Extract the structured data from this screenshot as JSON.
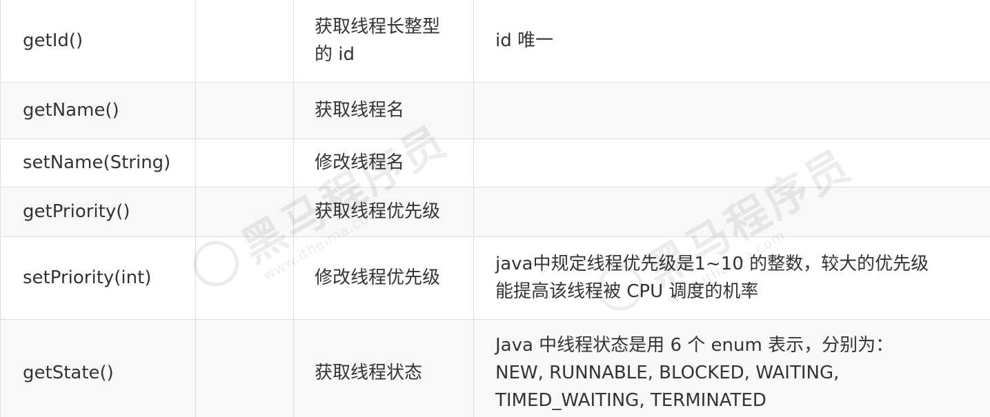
{
  "table": {
    "rows": [
      {
        "method": "getId()",
        "extra": "",
        "description": [
          "获取线程长整型",
          "的 id"
        ],
        "note": [
          "id 唯一"
        ]
      },
      {
        "method": "getName()",
        "extra": "",
        "description": [
          "获取线程名"
        ],
        "note": []
      },
      {
        "method": "setName(String)",
        "extra": "",
        "description": [
          "修改线程名"
        ],
        "note": []
      },
      {
        "method": "getPriority()",
        "extra": "",
        "description": [
          "获取线程优先级"
        ],
        "note": []
      },
      {
        "method": "setPriority(int)",
        "extra": "",
        "description": [
          "修改线程优先级"
        ],
        "note": [
          "java中规定线程优先级是1~10 的整数，较大的优先级",
          "能提高该线程被 CPU 调度的机率"
        ]
      },
      {
        "method": "getState()",
        "extra": "",
        "description": [
          "获取线程状态"
        ],
        "note": [
          "Java 中线程状态是用 6 个 enum 表示，分别为：",
          "NEW, RUNNABLE, BLOCKED, WAITING,",
          "TIMED_WAITING, TERMINATED"
        ]
      }
    ]
  },
  "watermark": {
    "brand": "黑马程序员",
    "url": "www.itheima.com",
    "logo_icon": "heima-logo-icon"
  }
}
